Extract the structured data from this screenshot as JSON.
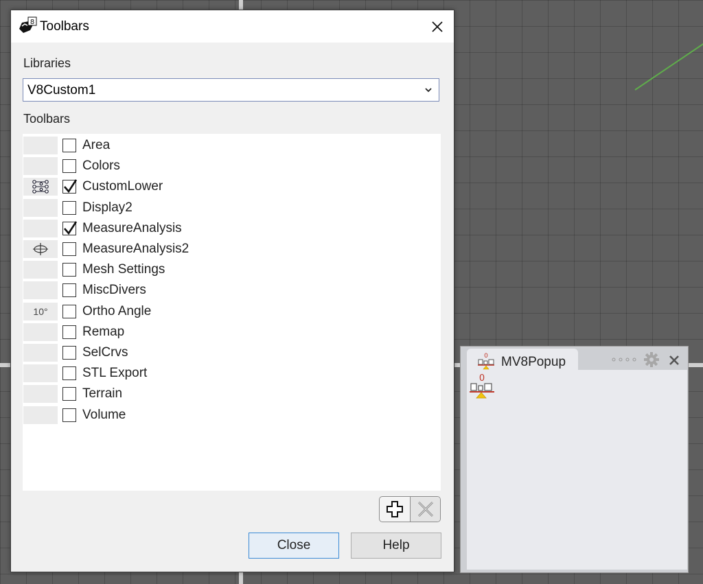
{
  "dialog": {
    "title": "Toolbars",
    "libraries_label": "Libraries",
    "library_selected": "V8Custom1",
    "toolbars_label": "Toolbars",
    "toolbars": [
      {
        "label": "Area",
        "checked": false,
        "icon": ""
      },
      {
        "label": "Colors",
        "checked": false,
        "icon": ""
      },
      {
        "label": "CustomLower",
        "checked": true,
        "icon": "nodes-icon"
      },
      {
        "label": "Display2",
        "checked": false,
        "icon": ""
      },
      {
        "label": "MeasureAnalysis",
        "checked": true,
        "icon": ""
      },
      {
        "label": "MeasureAnalysis2",
        "checked": false,
        "icon": "measure-circle-icon"
      },
      {
        "label": "Mesh Settings",
        "checked": false,
        "icon": ""
      },
      {
        "label": "MiscDivers",
        "checked": false,
        "icon": ""
      },
      {
        "label": "Ortho Angle",
        "checked": false,
        "icon": "angle-text-icon",
        "icon_text": "10°"
      },
      {
        "label": "Remap",
        "checked": false,
        "icon": ""
      },
      {
        "label": "SelCrvs",
        "checked": false,
        "icon": ""
      },
      {
        "label": "STL Export",
        "checked": false,
        "icon": ""
      },
      {
        "label": "Terrain",
        "checked": false,
        "icon": ""
      },
      {
        "label": "Volume",
        "checked": false,
        "icon": ""
      }
    ],
    "close_label": "Close",
    "help_label": "Help"
  },
  "panel": {
    "tab_label": "MV8Popup",
    "button_digit": "0"
  },
  "colors": {
    "accent_blue": "#3c8bd6",
    "popup_red": "#c0392b",
    "popup_yellow": "#f1c40f"
  }
}
